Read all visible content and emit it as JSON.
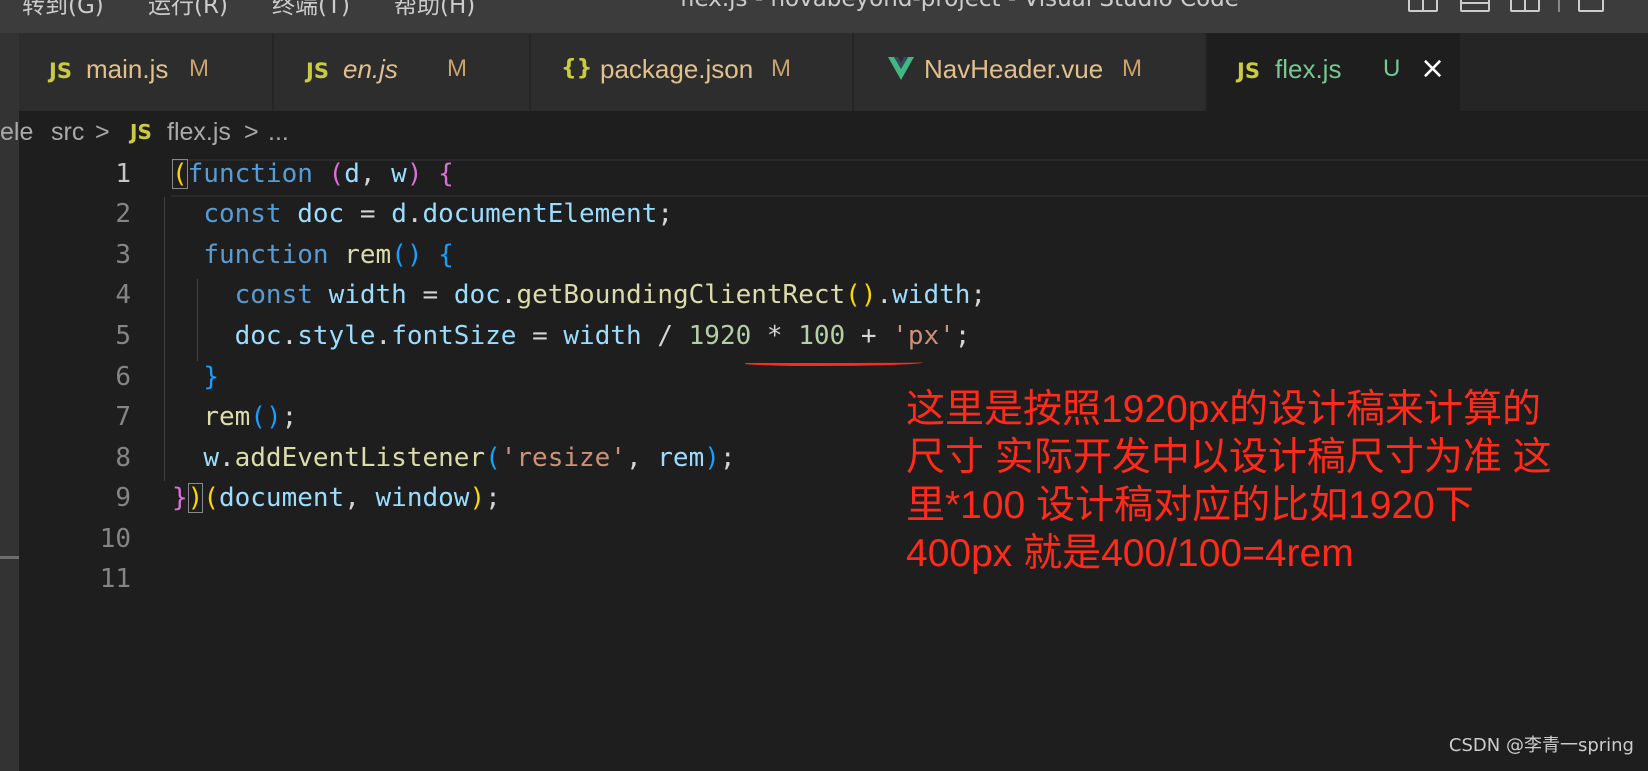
{
  "window": {
    "menu": [
      "转到(G)",
      "运行(R)",
      "终端(T)",
      "帮助(H)"
    ],
    "title": "flex.js - novabeyond-project - Visual Studio Code"
  },
  "tabs": [
    {
      "icon": "JS",
      "label": "main.js",
      "status": "M"
    },
    {
      "icon": "JS",
      "label": "en.js",
      "status": "M"
    },
    {
      "icon": "{}",
      "label": "package.json",
      "status": "M"
    },
    {
      "icon": "vue-icon",
      "label": "NavHeader.vue",
      "status": "M"
    },
    {
      "icon": "JS",
      "label": "flex.js",
      "status": "U",
      "close": "×"
    }
  ],
  "breadcrumb": {
    "cut_text": "ele",
    "folder": "src",
    "separator": ">",
    "file_icon": "JS",
    "file": "flex.js",
    "more": "..."
  },
  "editor": {
    "line_numbers": [
      "1",
      "2",
      "3",
      "4",
      "5",
      "6",
      "7",
      "8",
      "9",
      "10",
      "11"
    ],
    "active_line": 1,
    "code_lines": [
      "(function (d, w) {",
      "  const doc = d.documentElement;",
      "  function rem() {",
      "    const width = doc.getBoundingClientRect().width;",
      "    doc.style.fontSize = width / 1920 * 100 + 'px';",
      "  }",
      "  rem();",
      "  w.addEventListener('resize', rem);",
      "})(document, window);",
      "",
      ""
    ]
  },
  "annotation": {
    "lines": [
      "这里是按照1920px的设计稿来计算的",
      "尺寸 实际开发中以设计稿尺寸为准 这",
      "里*100 设计稿对应的比如1920下",
      "400px 就是400/100=4rem"
    ],
    "color": "#ff2a1a"
  },
  "watermark": "CSDN @李青一spring"
}
